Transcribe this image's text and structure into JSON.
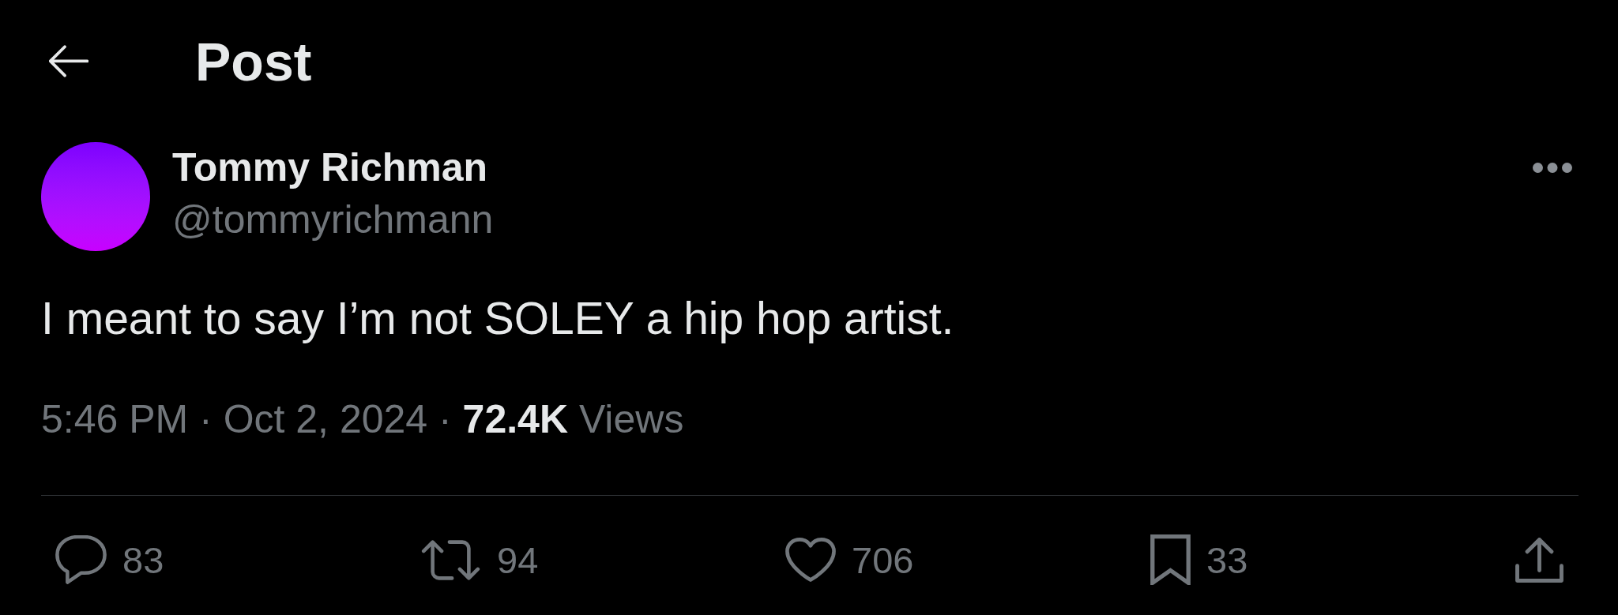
{
  "header": {
    "title": "Post"
  },
  "post": {
    "author": {
      "name": "Tommy Richman",
      "handle": "@tommyrichmann"
    },
    "text": "I meant to say I’m not SOLEY a hip hop artist.",
    "meta": "5:46 PM · Oct 2, 2024 · **72.4K** Views",
    "actions": [
      {
        "kind": "reply",
        "count": "83"
      },
      {
        "kind": "repost",
        "count": "94"
      },
      {
        "kind": "like",
        "count": "706"
      },
      {
        "kind": "bookmark",
        "count": "33"
      },
      {
        "kind": "share"
      }
    ]
  }
}
